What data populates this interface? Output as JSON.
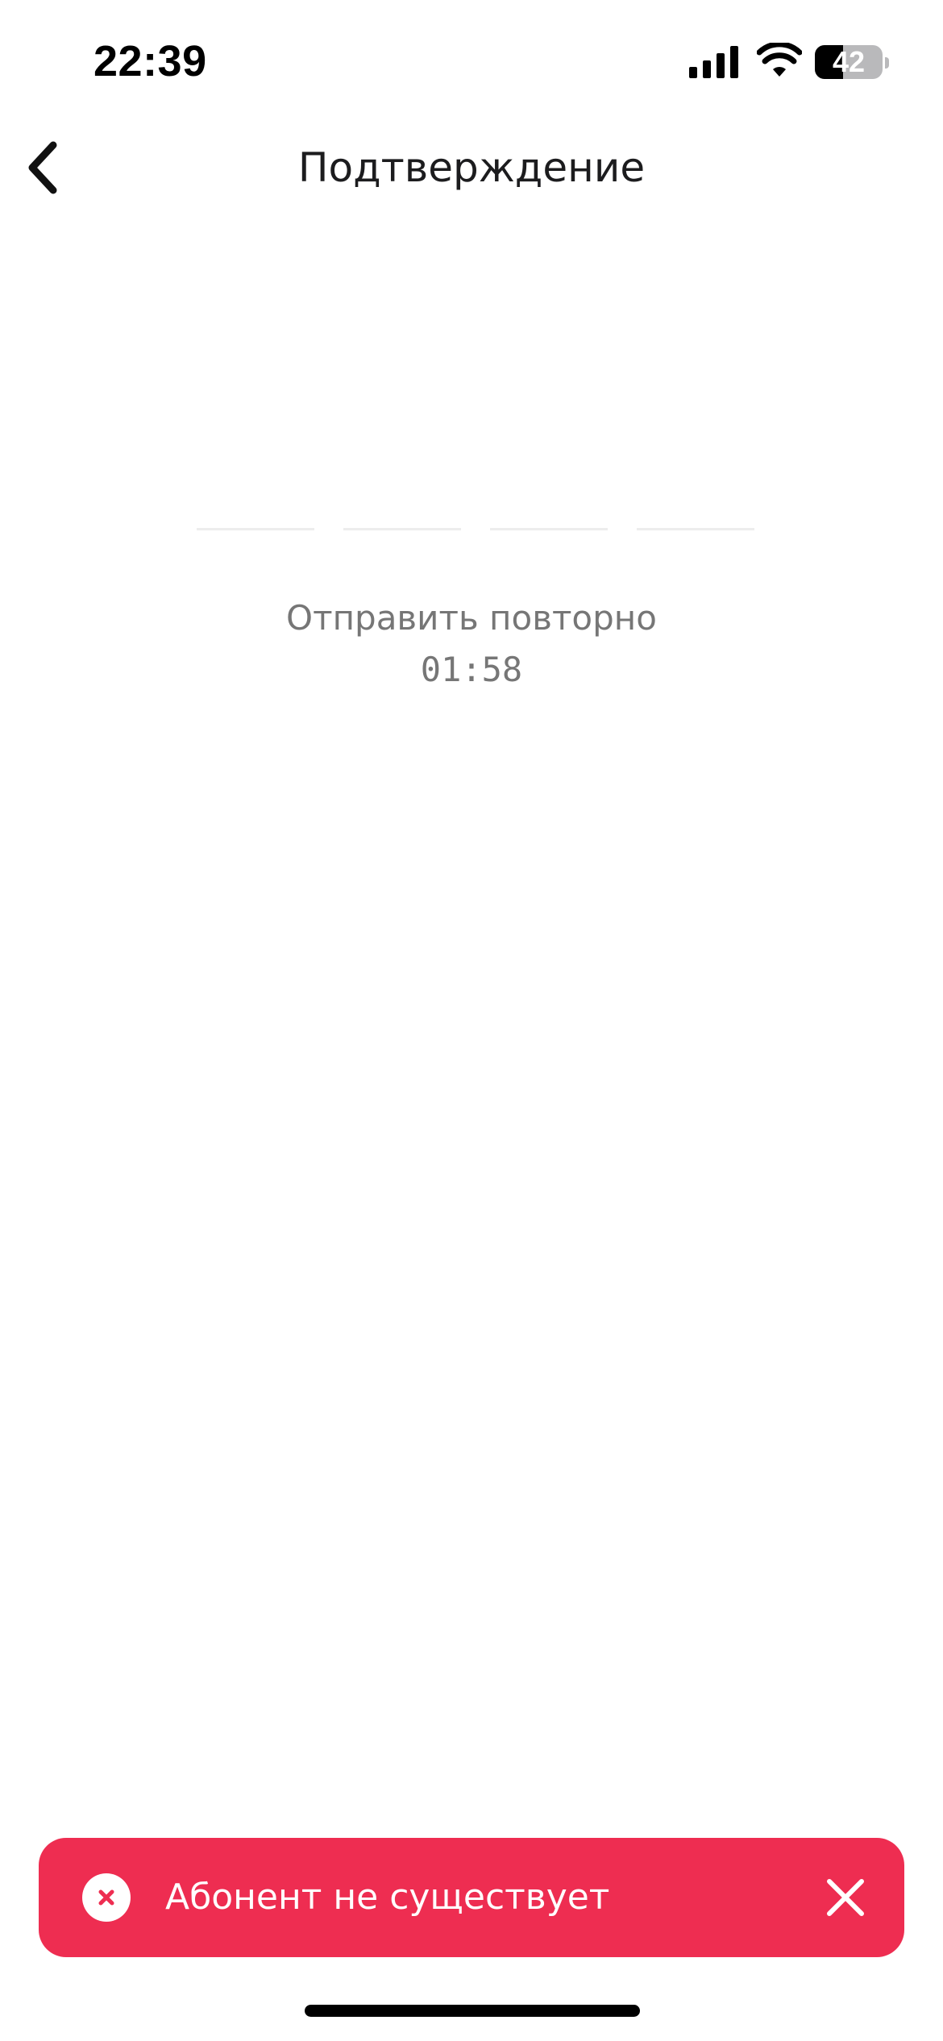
{
  "status_bar": {
    "time": "22:39",
    "battery_level": "42",
    "battery_fraction": 0.42,
    "icons": [
      "signal-icon",
      "wifi-icon",
      "battery-icon"
    ]
  },
  "header": {
    "back_icon": "chevron-left-icon",
    "title": "Подтверждение"
  },
  "code": {
    "length": 4,
    "digits": [
      "",
      "",
      "",
      ""
    ]
  },
  "resend": {
    "label": "Отправить повторно",
    "timer": "01:58"
  },
  "toast": {
    "icon": "error-circle-icon",
    "message": "Абонент не существует",
    "close_icon": "close-icon",
    "color": "#ee2d51"
  }
}
